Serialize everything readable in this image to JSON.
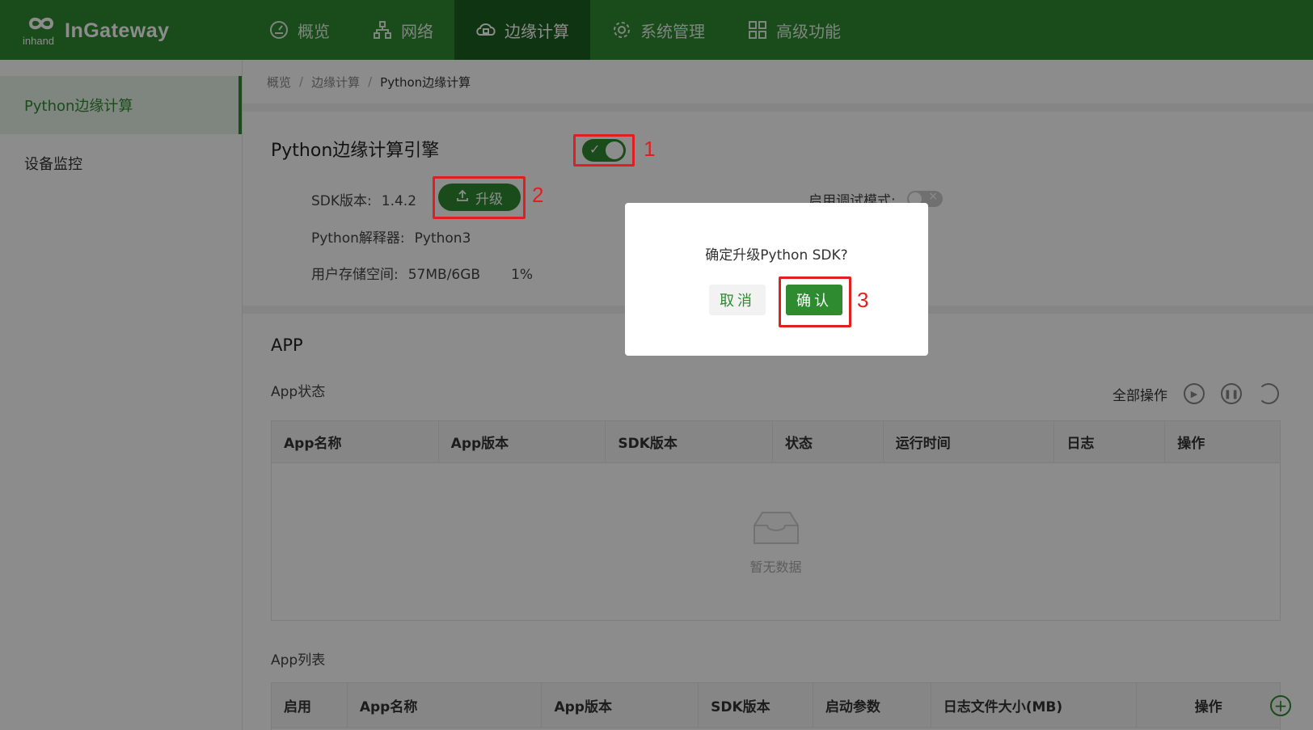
{
  "header": {
    "logo_small": "inhand",
    "logo_text": "InGateway",
    "nav": [
      {
        "label": "概览",
        "icon": "dashboard-icon"
      },
      {
        "label": "网络",
        "icon": "network-icon"
      },
      {
        "label": "边缘计算",
        "icon": "cloud-compute-icon",
        "active": true
      },
      {
        "label": "系统管理",
        "icon": "gear-icon"
      },
      {
        "label": "高级功能",
        "icon": "grid-icon"
      }
    ]
  },
  "sidebar": {
    "items": [
      {
        "label": "Python边缘计算",
        "active": true
      },
      {
        "label": "设备监控"
      }
    ]
  },
  "breadcrumb": [
    "概览",
    "边缘计算",
    "Python边缘计算"
  ],
  "engine": {
    "title": "Python边缘计算引擎",
    "enabled": true,
    "sdk_label": "SDK版本:",
    "sdk_value": "1.4.2",
    "upgrade_label": "升级",
    "interpreter_label": "Python解释器:",
    "interpreter_value": "Python3",
    "storage_label": "用户存储空间:",
    "storage_value": "57MB/6GB",
    "storage_percent": "1%",
    "debug_label": "启用调试模式:",
    "debug_enabled": false
  },
  "app": {
    "title": "APP",
    "status_label": "App状态",
    "all_ops_label": "全部操作",
    "status_columns": [
      "App名称",
      "App版本",
      "SDK版本",
      "状态",
      "运行时间",
      "日志",
      "操作"
    ],
    "empty_text": "暂无数据",
    "list_label": "App列表",
    "list_columns": [
      "启用",
      "App名称",
      "App版本",
      "SDK版本",
      "启动参数",
      "日志文件大小(MB)",
      "操作"
    ]
  },
  "annotations": [
    "1",
    "2",
    "3"
  ],
  "dialog": {
    "message": "确定升级Python SDK?",
    "cancel_label": "取消",
    "confirm_label": "确认"
  },
  "colors": {
    "brand": "#2e8b30",
    "nav_active": "#1d5f1f",
    "annotation": "#e02020"
  }
}
